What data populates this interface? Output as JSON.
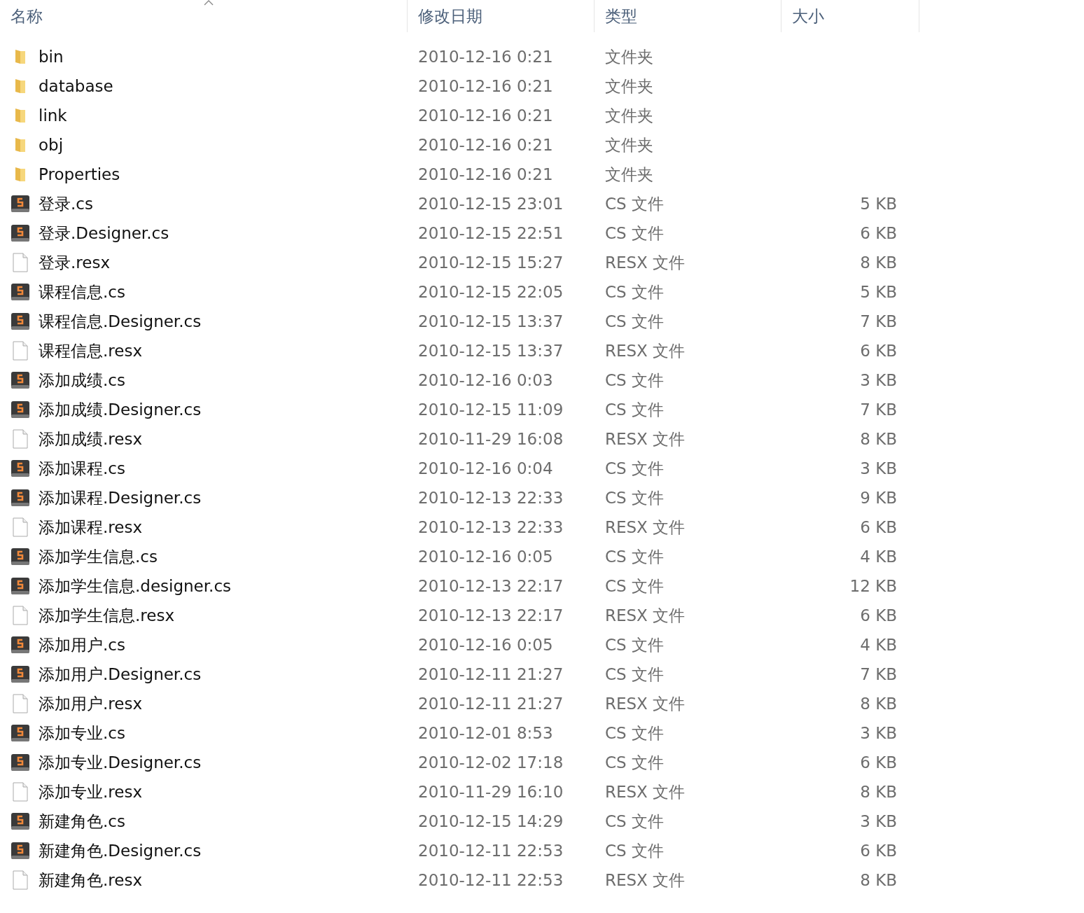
{
  "columns": [
    {
      "label": "名称",
      "sorted": true
    },
    {
      "label": "修改日期",
      "sorted": false
    },
    {
      "label": "类型",
      "sorted": false
    },
    {
      "label": "大小",
      "sorted": false
    }
  ],
  "files": [
    {
      "kind": "folder",
      "name": "bin",
      "modified": "2010-12-16 0:21",
      "type": "文件夹"
    },
    {
      "kind": "folder",
      "name": "database",
      "modified": "2010-12-16 0:21",
      "type": "文件夹"
    },
    {
      "kind": "folder",
      "name": "link",
      "modified": "2010-12-16 0:21",
      "type": "文件夹"
    },
    {
      "kind": "folder",
      "name": "obj",
      "modified": "2010-12-16 0:21",
      "type": "文件夹"
    },
    {
      "kind": "folder",
      "name": "Properties",
      "modified": "2010-12-16 0:21",
      "type": "文件夹"
    },
    {
      "kind": "cs",
      "name": "登录.cs",
      "modified": "2010-12-15 23:01",
      "type": "CS 文件",
      "size": "5 KB"
    },
    {
      "kind": "cs",
      "name": "登录.Designer.cs",
      "modified": "2010-12-15 22:51",
      "type": "CS 文件",
      "size": "6 KB"
    },
    {
      "kind": "resx",
      "name": "登录.resx",
      "modified": "2010-12-15 15:27",
      "type": "RESX 文件",
      "size": "8 KB"
    },
    {
      "kind": "cs",
      "name": "课程信息.cs",
      "modified": "2010-12-15 22:05",
      "type": "CS 文件",
      "size": "5 KB"
    },
    {
      "kind": "cs",
      "name": "课程信息.Designer.cs",
      "modified": "2010-12-15 13:37",
      "type": "CS 文件",
      "size": "7 KB"
    },
    {
      "kind": "resx",
      "name": "课程信息.resx",
      "modified": "2010-12-15 13:37",
      "type": "RESX 文件",
      "size": "6 KB"
    },
    {
      "kind": "cs",
      "name": "添加成绩.cs",
      "modified": "2010-12-16 0:03",
      "type": "CS 文件",
      "size": "3 KB"
    },
    {
      "kind": "cs",
      "name": "添加成绩.Designer.cs",
      "modified": "2010-12-15 11:09",
      "type": "CS 文件",
      "size": "7 KB"
    },
    {
      "kind": "resx",
      "name": "添加成绩.resx",
      "modified": "2010-11-29 16:08",
      "type": "RESX 文件",
      "size": "8 KB"
    },
    {
      "kind": "cs",
      "name": "添加课程.cs",
      "modified": "2010-12-16 0:04",
      "type": "CS 文件",
      "size": "3 KB"
    },
    {
      "kind": "cs",
      "name": "添加课程.Designer.cs",
      "modified": "2010-12-13 22:33",
      "type": "CS 文件",
      "size": "9 KB"
    },
    {
      "kind": "resx",
      "name": "添加课程.resx",
      "modified": "2010-12-13 22:33",
      "type": "RESX 文件",
      "size": "6 KB"
    },
    {
      "kind": "cs",
      "name": "添加学生信息.cs",
      "modified": "2010-12-16 0:05",
      "type": "CS 文件",
      "size": "4 KB"
    },
    {
      "kind": "cs",
      "name": "添加学生信息.designer.cs",
      "modified": "2010-12-13 22:17",
      "type": "CS 文件",
      "size": "12 KB"
    },
    {
      "kind": "resx",
      "name": "添加学生信息.resx",
      "modified": "2010-12-13 22:17",
      "type": "RESX 文件",
      "size": "6 KB"
    },
    {
      "kind": "cs",
      "name": "添加用户.cs",
      "modified": "2010-12-16 0:05",
      "type": "CS 文件",
      "size": "4 KB"
    },
    {
      "kind": "cs",
      "name": "添加用户.Designer.cs",
      "modified": "2010-12-11 21:27",
      "type": "CS 文件",
      "size": "7 KB"
    },
    {
      "kind": "resx",
      "name": "添加用户.resx",
      "modified": "2010-12-11 21:27",
      "type": "RESX 文件",
      "size": "8 KB"
    },
    {
      "kind": "cs",
      "name": "添加专业.cs",
      "modified": "2010-12-01 8:53",
      "type": "CS 文件",
      "size": "3 KB"
    },
    {
      "kind": "cs",
      "name": "添加专业.Designer.cs",
      "modified": "2010-12-02 17:18",
      "type": "CS 文件",
      "size": "6 KB"
    },
    {
      "kind": "resx",
      "name": "添加专业.resx",
      "modified": "2010-11-29 16:10",
      "type": "RESX 文件",
      "size": "8 KB"
    },
    {
      "kind": "cs",
      "name": "新建角色.cs",
      "modified": "2010-12-15 14:29",
      "type": "CS 文件",
      "size": "3 KB"
    },
    {
      "kind": "cs",
      "name": "新建角色.Designer.cs",
      "modified": "2010-12-11 22:53",
      "type": "CS 文件",
      "size": "6 KB"
    },
    {
      "kind": "resx",
      "name": "新建角色.resx",
      "modified": "2010-12-11 22:53",
      "type": "RESX 文件",
      "size": "8 KB"
    }
  ]
}
